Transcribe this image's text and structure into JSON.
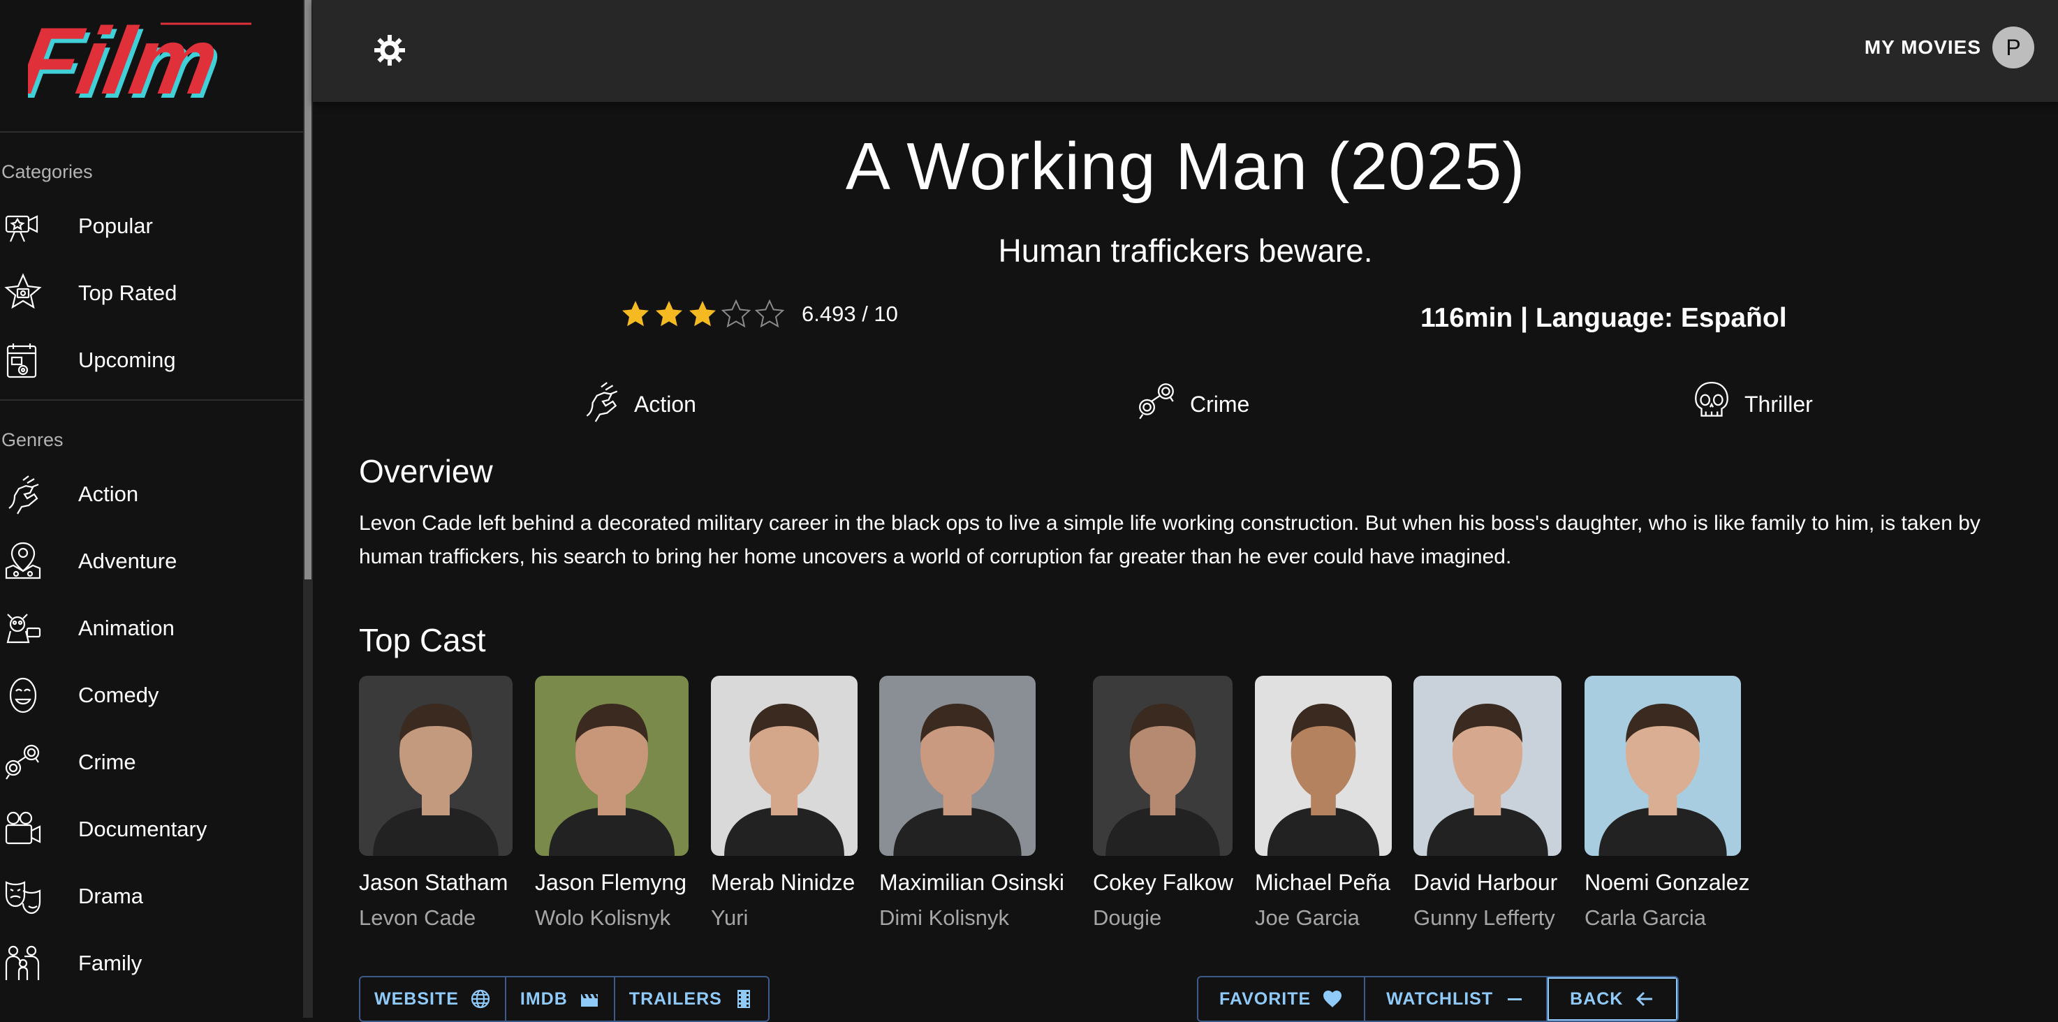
{
  "app": {
    "logo_text": "Film"
  },
  "sidebar": {
    "categories_label": "Categories",
    "categories": [
      {
        "label": "Popular",
        "icon": "popular-icon"
      },
      {
        "label": "Top Rated",
        "icon": "top-rated-icon"
      },
      {
        "label": "Upcoming",
        "icon": "upcoming-icon"
      }
    ],
    "genres_label": "Genres",
    "genres": [
      {
        "label": "Action",
        "icon": "action-icon"
      },
      {
        "label": "Adventure",
        "icon": "adventure-icon"
      },
      {
        "label": "Animation",
        "icon": "animation-icon"
      },
      {
        "label": "Comedy",
        "icon": "comedy-icon"
      },
      {
        "label": "Crime",
        "icon": "crime-icon"
      },
      {
        "label": "Documentary",
        "icon": "documentary-icon"
      },
      {
        "label": "Drama",
        "icon": "drama-icon"
      },
      {
        "label": "Family",
        "icon": "family-icon"
      }
    ]
  },
  "topbar": {
    "theme_icon": "brightness-icon",
    "my_movies_label": "MY MOVIES",
    "avatar_initial": "P"
  },
  "movie": {
    "title": "A Working Man (2025)",
    "tagline": "Human traffickers beware.",
    "stars_filled": 3,
    "stars_total": 5,
    "rating_text": "6.493 / 10",
    "runtime_language": "116min | Language: Español",
    "genres": [
      {
        "label": "Action",
        "icon": "action-icon"
      },
      {
        "label": "Crime",
        "icon": "crime-icon"
      },
      {
        "label": "Thriller",
        "icon": "thriller-icon"
      }
    ],
    "overview_heading": "Overview",
    "overview": "Levon Cade left behind a decorated military career in the black ops to live a simple life working construction. But when his boss's daughter, who is like family to him, is taken by human traffickers, his search to bring her home uncovers a world of corruption far greater than he ever could have imagined.",
    "cast_heading": "Top Cast",
    "cast": [
      {
        "name": "Jason Statham",
        "character": "Levon Cade",
        "bg": "#3a3a3a",
        "skin": "#c49a7e"
      },
      {
        "name": "Jason Flemyng",
        "character": "Wolo Kolisnyk",
        "bg": "#7a8a4a",
        "skin": "#c8977a"
      },
      {
        "name": "Merab Ninidze",
        "character": "Yuri",
        "bg": "#d9d9d9",
        "skin": "#d4a68a"
      },
      {
        "name": "Maximilian Osinski",
        "character": "Dimi Kolisnyk",
        "bg": "#8a8f95",
        "skin": "#c99a7f"
      },
      {
        "name": "Cokey Falkow",
        "character": "Dougie",
        "bg": "#3b3b3b",
        "skin": "#b58a70"
      },
      {
        "name": "Michael Peña",
        "character": "Joe Garcia",
        "bg": "#e0e0e0",
        "skin": "#b5825f"
      },
      {
        "name": "David Harbour",
        "character": "Gunny Lefferty",
        "bg": "#c9d2da",
        "skin": "#d6a88e"
      },
      {
        "name": "Noemi Gonzalez",
        "character": "Carla Garcia",
        "bg": "#a9cde0",
        "skin": "#d9ae92"
      }
    ],
    "links": [
      {
        "label": "WEBSITE",
        "icon": "globe-icon"
      },
      {
        "label": "IMDB",
        "icon": "movie-icon"
      },
      {
        "label": "TRAILERS",
        "icon": "film-strip-icon"
      }
    ],
    "actions": [
      {
        "label": "FAVORITE",
        "icon": "heart-icon"
      },
      {
        "label": "WATCHLIST",
        "icon": "minus-icon"
      },
      {
        "label": "BACK",
        "icon": "arrow-left-icon"
      }
    ]
  },
  "colors": {
    "background": "#121212",
    "topbar": "#272727",
    "accent": "#90caf9",
    "star": "#f5b921",
    "logo_red": "#e0303a"
  }
}
